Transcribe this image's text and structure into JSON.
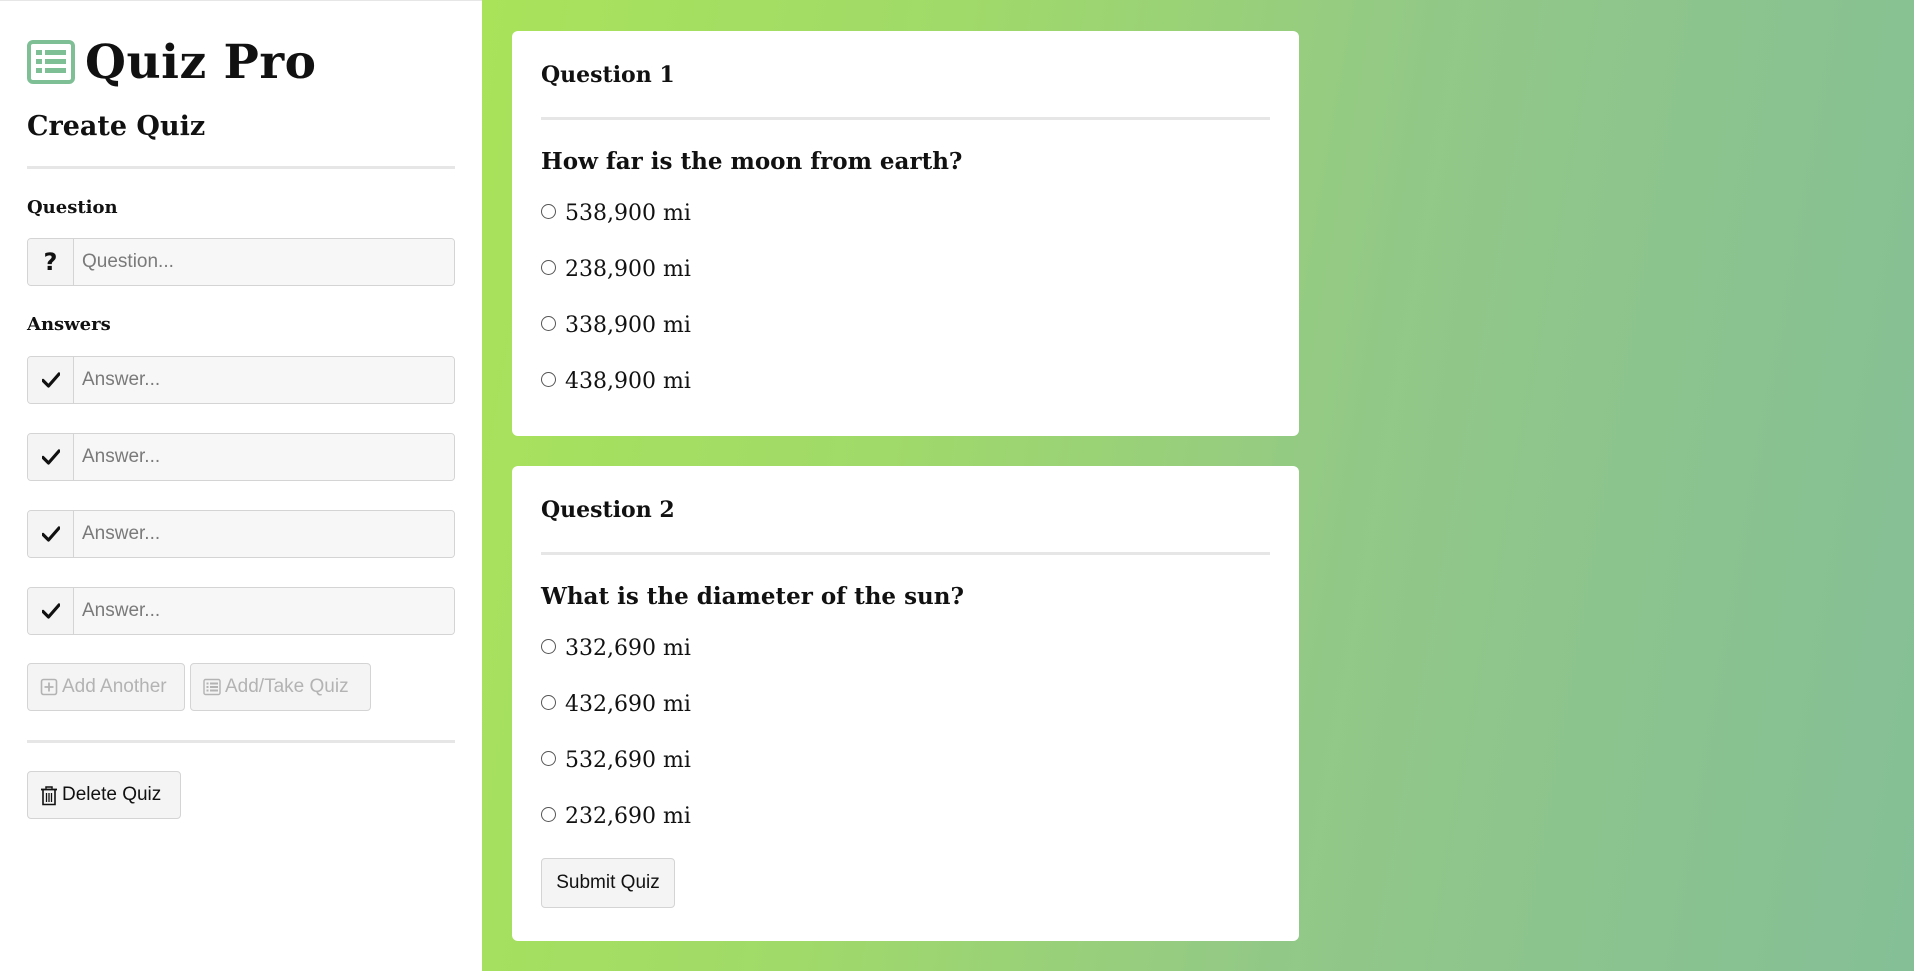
{
  "brand": {
    "title": "Quiz Pro",
    "icon": "list-icon",
    "icon_color": "#7fbf96"
  },
  "sidebar": {
    "heading": "Create Quiz",
    "question_label": "Question",
    "question_placeholder": "Question...",
    "question_addon": "?",
    "answers_label": "Answers",
    "answer_placeholders": [
      "Answer...",
      "Answer...",
      "Answer...",
      "Answer..."
    ],
    "add_another_label": "Add Another",
    "add_take_label": "Add/Take Quiz",
    "delete_label": "Delete Quiz"
  },
  "quiz": {
    "questions": [
      {
        "title": "Question 1",
        "text": "How far is the moon from earth?",
        "options": [
          "538,900 mi",
          "238,900 mi",
          "338,900 mi",
          "438,900 mi"
        ]
      },
      {
        "title": "Question 2",
        "text": "What is the diameter of the sun?",
        "options": [
          "332,690 mi",
          "432,690 mi",
          "532,690 mi",
          "232,690 mi"
        ]
      }
    ],
    "submit_label": "Submit Quiz"
  },
  "colors": {
    "gradient_start": "#a9e35a",
    "gradient_end": "#84bf96",
    "disabled_text": "#b3b3b3"
  }
}
